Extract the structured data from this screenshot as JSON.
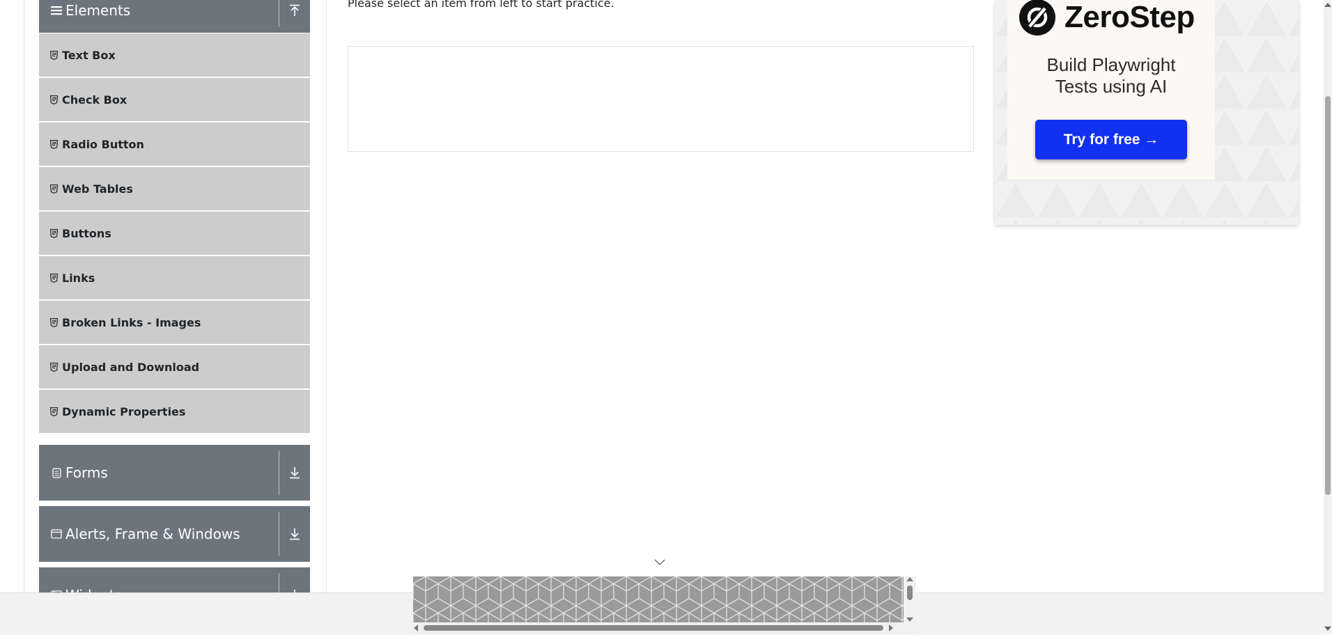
{
  "sidebar": {
    "elements_group": {
      "title": "Elements"
    },
    "items": [
      {
        "label": "Text Box"
      },
      {
        "label": "Check Box"
      },
      {
        "label": "Radio Button"
      },
      {
        "label": "Web Tables"
      },
      {
        "label": "Buttons"
      },
      {
        "label": "Links"
      },
      {
        "label": "Broken Links - Images"
      },
      {
        "label": "Upload and Download"
      },
      {
        "label": "Dynamic Properties"
      }
    ],
    "groups": [
      {
        "title": "Forms"
      },
      {
        "title": "Alerts, Frame & Windows"
      },
      {
        "title": "Widgets"
      }
    ]
  },
  "main": {
    "instruction": "Please select an item from left to start practice."
  },
  "ad": {
    "brand": "ZeroStep",
    "headline_line1": "Build Playwright",
    "headline_line2": "Tests using AI",
    "cta": "Try for free →",
    "cta_color": "#1230f0"
  },
  "colors": {
    "group_header": "#6c757d",
    "menu_item": "#cccccc"
  }
}
